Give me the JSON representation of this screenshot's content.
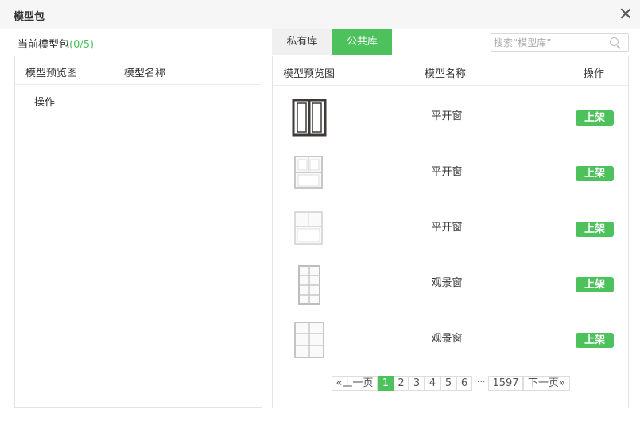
{
  "dialog": {
    "title": "模型包"
  },
  "left": {
    "header_label": "当前模型包",
    "count": "(0/5)",
    "col_preview": "模型预览图",
    "col_name": "模型名称",
    "action_label": "操作"
  },
  "tabs": {
    "private": "私有库",
    "public": "公共库"
  },
  "search": {
    "placeholder": "搜索“模型库”"
  },
  "right": {
    "col_preview": "模型预览图",
    "col_name": "模型名称",
    "col_action": "操作",
    "rows": [
      {
        "name": "平开窗",
        "button": "上架"
      },
      {
        "name": "平开窗",
        "button": "上架"
      },
      {
        "name": "平开窗",
        "button": "上架"
      },
      {
        "name": "观景窗",
        "button": "上架"
      },
      {
        "name": "观景窗",
        "button": "上架"
      }
    ]
  },
  "pagination": {
    "prev": "«上一页",
    "pages": [
      "1",
      "2",
      "3",
      "4",
      "5",
      "6"
    ],
    "ellipsis": "···",
    "last": "1597",
    "next": "下一页»",
    "current": "1"
  },
  "colors": {
    "accent": "#4cc15c"
  }
}
